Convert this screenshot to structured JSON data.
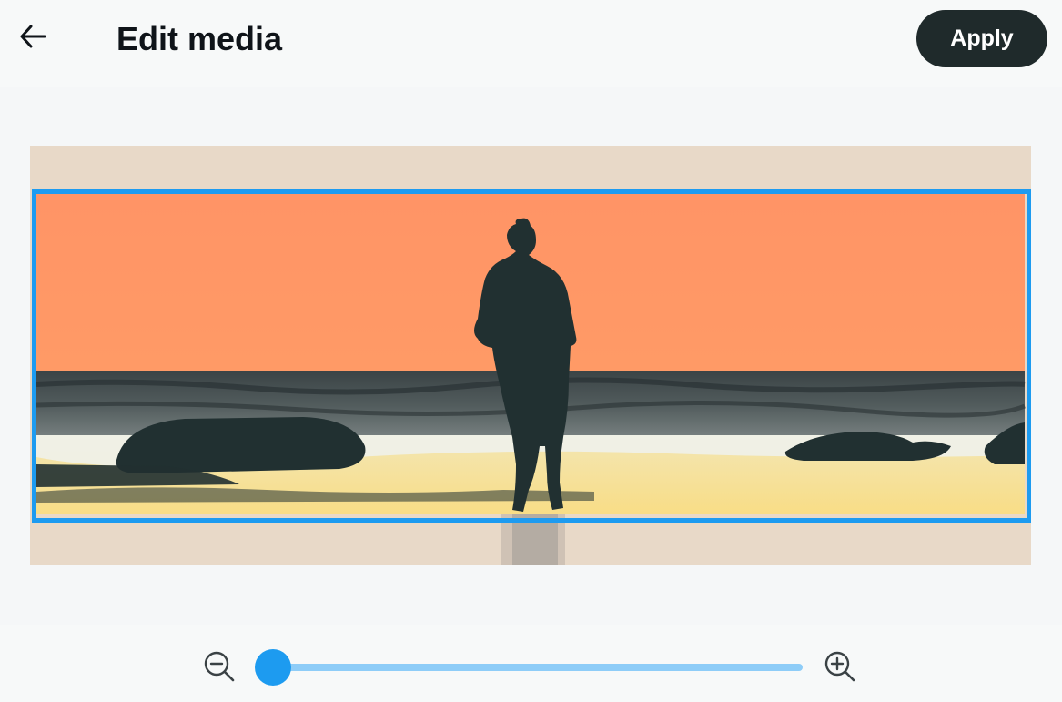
{
  "header": {
    "back_icon": "arrow-left-icon",
    "title": "Edit media",
    "apply_label": "Apply"
  },
  "editor": {
    "image_description_icon": "beach-sunset-silhouette",
    "crop_frame_color": "#1d9bf0"
  },
  "zoom": {
    "zoom_out_icon": "zoom-out-icon",
    "zoom_in_icon": "zoom-in-icon",
    "level_fraction": 0.0,
    "accent_color": "#1d9bf0"
  },
  "colors": {
    "apply_bg": "#1f2a2b",
    "accent": "#1d9bf0"
  }
}
